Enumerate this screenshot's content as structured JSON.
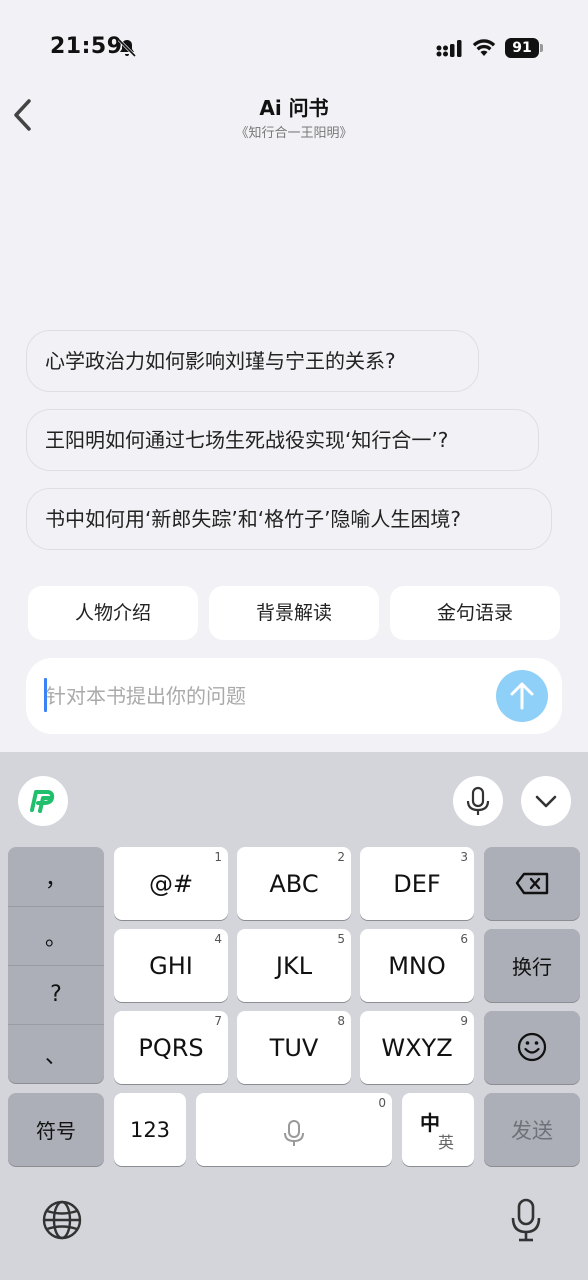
{
  "status_bar": {
    "time": "21:59",
    "battery": "91"
  },
  "header": {
    "title": "Ai 问书",
    "subtitle": "《知行合一王阳明》"
  },
  "suggestions": [
    "心学政治力如何影响刘瑾与宁王的关系?",
    "王阳明如何通过七场生死战役实现‘知行合一’?",
    "书中如何用‘新郎失踪’和‘格竹子’隐喻人生困境?"
  ],
  "chips": [
    "人物介绍",
    "背景解读",
    "金句语录"
  ],
  "input": {
    "placeholder": "针对本书提出你的问题"
  },
  "keyboard": {
    "punctuation": [
      "，",
      "。",
      "?",
      "、"
    ],
    "keys": [
      {
        "label": "@#",
        "num": "1"
      },
      {
        "label": "ABC",
        "num": "2"
      },
      {
        "label": "DEF",
        "num": "3"
      },
      {
        "label": "GHI",
        "num": "4"
      },
      {
        "label": "JKL",
        "num": "5"
      },
      {
        "label": "MNO",
        "num": "6"
      },
      {
        "label": "PQRS",
        "num": "7"
      },
      {
        "label": "TUV",
        "num": "8"
      },
      {
        "label": "WXYZ",
        "num": "9"
      }
    ],
    "newline_label": "换行",
    "symbols_label": "符号",
    "num_label": "123",
    "space_num": "0",
    "lang_primary": "中",
    "lang_secondary": "英",
    "send_label": "发送"
  },
  "colors": {
    "accent": "#8fd0f8",
    "cursor": "#3b82f6",
    "logo_green": "#1fbf6b"
  },
  "icons": [
    "bell-slash-icon",
    "signal-icon",
    "wifi-icon",
    "battery-icon",
    "back-chevron-icon",
    "arrow-up-icon",
    "pinyin-logo-icon",
    "mic-icon",
    "chevron-down-icon",
    "delete-icon",
    "emoji-icon",
    "globe-icon"
  ]
}
